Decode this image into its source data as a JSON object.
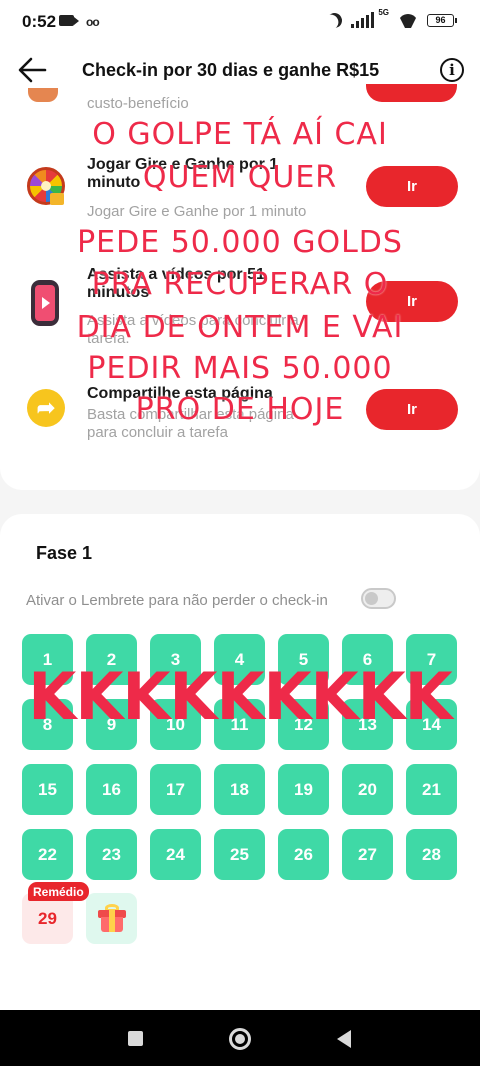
{
  "status_bar": {
    "time": "0:52",
    "network": "5G",
    "battery": "96"
  },
  "header": {
    "title": "Check-in por 30 dias e ganhe R$15"
  },
  "tasks": {
    "partial_desc": "custo-benefício",
    "items": [
      {
        "name": "Jogar Gire e Ganhe por 1 minuto",
        "desc": "Jogar Gire e Ganhe por 1 minuto",
        "button": "Ir",
        "icon": "prize-wheel-icon"
      },
      {
        "name": "Assista a vídeos por 51 minutos",
        "desc": "Assista a vídeos para concluir a tarefa.",
        "button": "Ir",
        "icon": "video-phone-icon"
      },
      {
        "name": "Compartilhe esta página",
        "desc": "Basta compartilhar esta página para concluir a tarefa",
        "button": "Ir",
        "icon": "share-arrow-icon"
      }
    ]
  },
  "phase": {
    "title": "Fase 1",
    "reminder_text": "Ativar o Lembrete para não perder o check-in",
    "reminder_on": false,
    "days": [
      "1",
      "2",
      "3",
      "4",
      "5",
      "6",
      "7",
      "8",
      "9",
      "10",
      "11",
      "12",
      "13",
      "14",
      "15",
      "16",
      "17",
      "18",
      "19",
      "20",
      "21",
      "22",
      "23",
      "24",
      "25",
      "26",
      "27",
      "28",
      "29"
    ],
    "remedy_badge": "Remédio",
    "final_reward_icon": "gift-box-icon"
  },
  "overlay": {
    "lines": [
      "O GOLPE TÁ AÍ CAI",
      "QUEM QUER",
      "PEDE 50.000 GOLDS",
      "PRA RECUPERAR O",
      "DIA DE ONTEM E VAI",
      "PEDIR MAIS 50.000",
      "PRO DE HOJE"
    ],
    "big": "KKKKKKKKK"
  },
  "colors": {
    "accent_red": "#e8262c",
    "day_green": "#3fd9a6",
    "overlay_text": "#ee2a49"
  }
}
